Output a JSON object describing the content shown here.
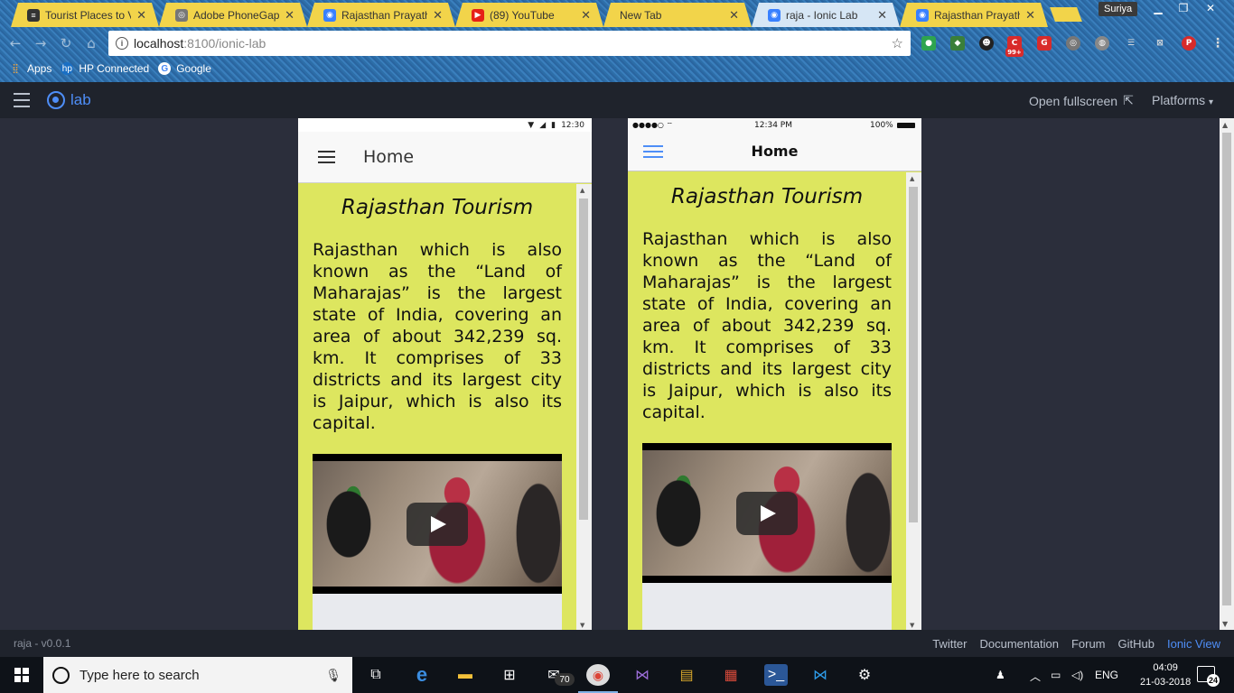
{
  "browser": {
    "tabs": [
      {
        "label": "Tourist Places to Vi",
        "favicon_color": "#333333"
      },
      {
        "label": "Adobe PhoneGap B",
        "favicon_color": "#666666"
      },
      {
        "label": "Rajasthan Prayatha",
        "favicon_color": "#3880ff"
      },
      {
        "label": "(89) YouTube",
        "favicon_color": "#e62117"
      },
      {
        "label": "New Tab",
        "favicon_color": ""
      },
      {
        "label": "raja - Ionic Lab",
        "favicon_color": "#3880ff"
      },
      {
        "label": "Rajasthan Prayatha",
        "favicon_color": "#3880ff"
      }
    ],
    "profile_name": "Suriya",
    "url_host": "localhost",
    "url_path": ":8100/ionic-lab",
    "bookmarks": [
      "Apps",
      "HP Connected",
      "Google"
    ],
    "extension_badge": "99+"
  },
  "lab": {
    "logo_text": "lab",
    "open_fullscreen": "Open fullscreen",
    "platforms": "Platforms",
    "version": "raja - v0.0.1",
    "footer_links": [
      "Twitter",
      "Documentation",
      "Forum",
      "GitHub",
      "Ionic View"
    ]
  },
  "android": {
    "status_time": "12:30",
    "title": "Home"
  },
  "ios": {
    "status_time": "12:34 PM",
    "status_battery": "100%",
    "title": "Home"
  },
  "page": {
    "heading": "Rajasthan Tourism",
    "body": "Rajasthan which is also known as the “Land of Maharajas” is the largest state of India, covering an area of about 342,239 sq. km. It comprises of 33 districts and its largest city is Jaipur, which is also its capital."
  },
  "taskbar": {
    "search_placeholder": "Type here to search",
    "mail_badge": "70",
    "language": "ENG",
    "time": "04:09",
    "date": "21-03-2018",
    "notifications": "24"
  }
}
